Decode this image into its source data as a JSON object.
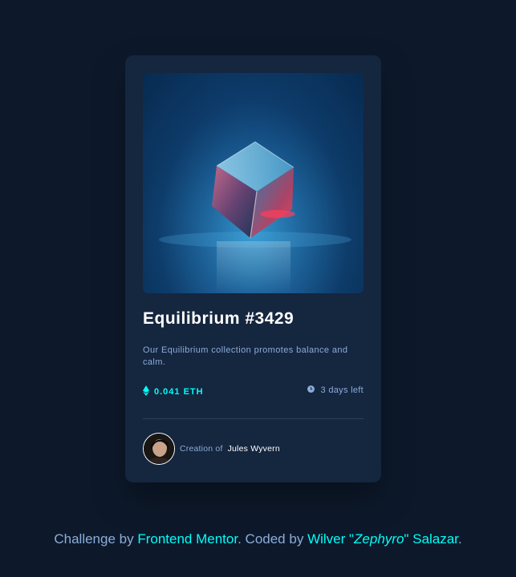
{
  "card": {
    "image_alt": "Equilibrium crystal cube",
    "title": "Equilibrium #3429",
    "description": "Our Equilibrium collection promotes balance and calm.",
    "price": "0.041 ETH",
    "time_left": "3 days left",
    "creator_prefix": "Creation of",
    "creator_name": "Jules Wyvern"
  },
  "attribution": {
    "prefix": "Challenge by",
    "challenge_link": "Frontend Mentor",
    "middle": ". Coded by",
    "author_first": "Wilver \"",
    "author_nick": "Zephyro",
    "author_last": "\" Salazar",
    "suffix": "."
  },
  "icons": {
    "price": "ethereum-icon",
    "time": "clock-icon"
  },
  "colors": {
    "page_bg": "#0d192b",
    "card_bg": "#15263f",
    "accent_cyan": "#00fff8",
    "muted_blue": "#8bacd9",
    "divider": "#2e405a",
    "white": "#ffffff"
  }
}
